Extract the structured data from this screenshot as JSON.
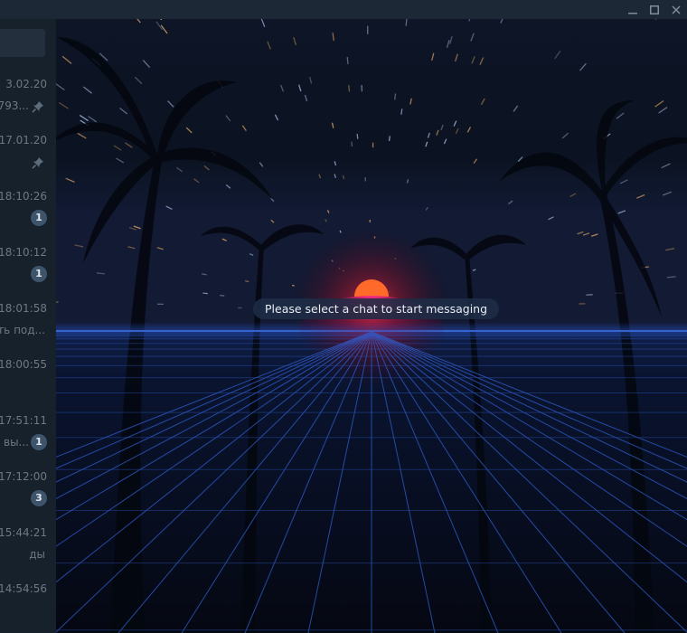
{
  "window": {
    "controls": [
      "minimize-icon",
      "maximize-icon",
      "close-icon"
    ]
  },
  "sidebar": {
    "chats": [
      {
        "time": "3.02.20",
        "preview": "793...",
        "pinned": true,
        "unread": null
      },
      {
        "time": "17.01.20",
        "preview": "",
        "pinned": true,
        "unread": null
      },
      {
        "time": "18:10:26",
        "preview": "",
        "pinned": false,
        "unread": "1"
      },
      {
        "time": "18:10:12",
        "preview": "",
        "pinned": false,
        "unread": "1"
      },
      {
        "time": "18:01:58",
        "preview": "ть под...",
        "pinned": false,
        "unread": null
      },
      {
        "time": "18:00:55",
        "preview": "",
        "pinned": false,
        "unread": null
      },
      {
        "time": "17:51:11",
        "preview": "вы...",
        "pinned": false,
        "unread": "1"
      },
      {
        "time": "17:12:00",
        "preview": "",
        "pinned": false,
        "unread": "3"
      },
      {
        "time": "15:44:21",
        "preview": "ды",
        "pinned": false,
        "unread": null
      },
      {
        "time": "14:54:56",
        "preview": "",
        "pinned": false,
        "unread": null
      }
    ]
  },
  "main": {
    "empty_message": "Please select a chat to start messaging"
  },
  "colors": {
    "titlebar": "#1c2835",
    "sidebar": "#17212b",
    "badge": "#3e546a",
    "muted_text": "#6d7883",
    "horizon_glow": "#ff2a6d",
    "grid_line": "#2f5fd0"
  }
}
